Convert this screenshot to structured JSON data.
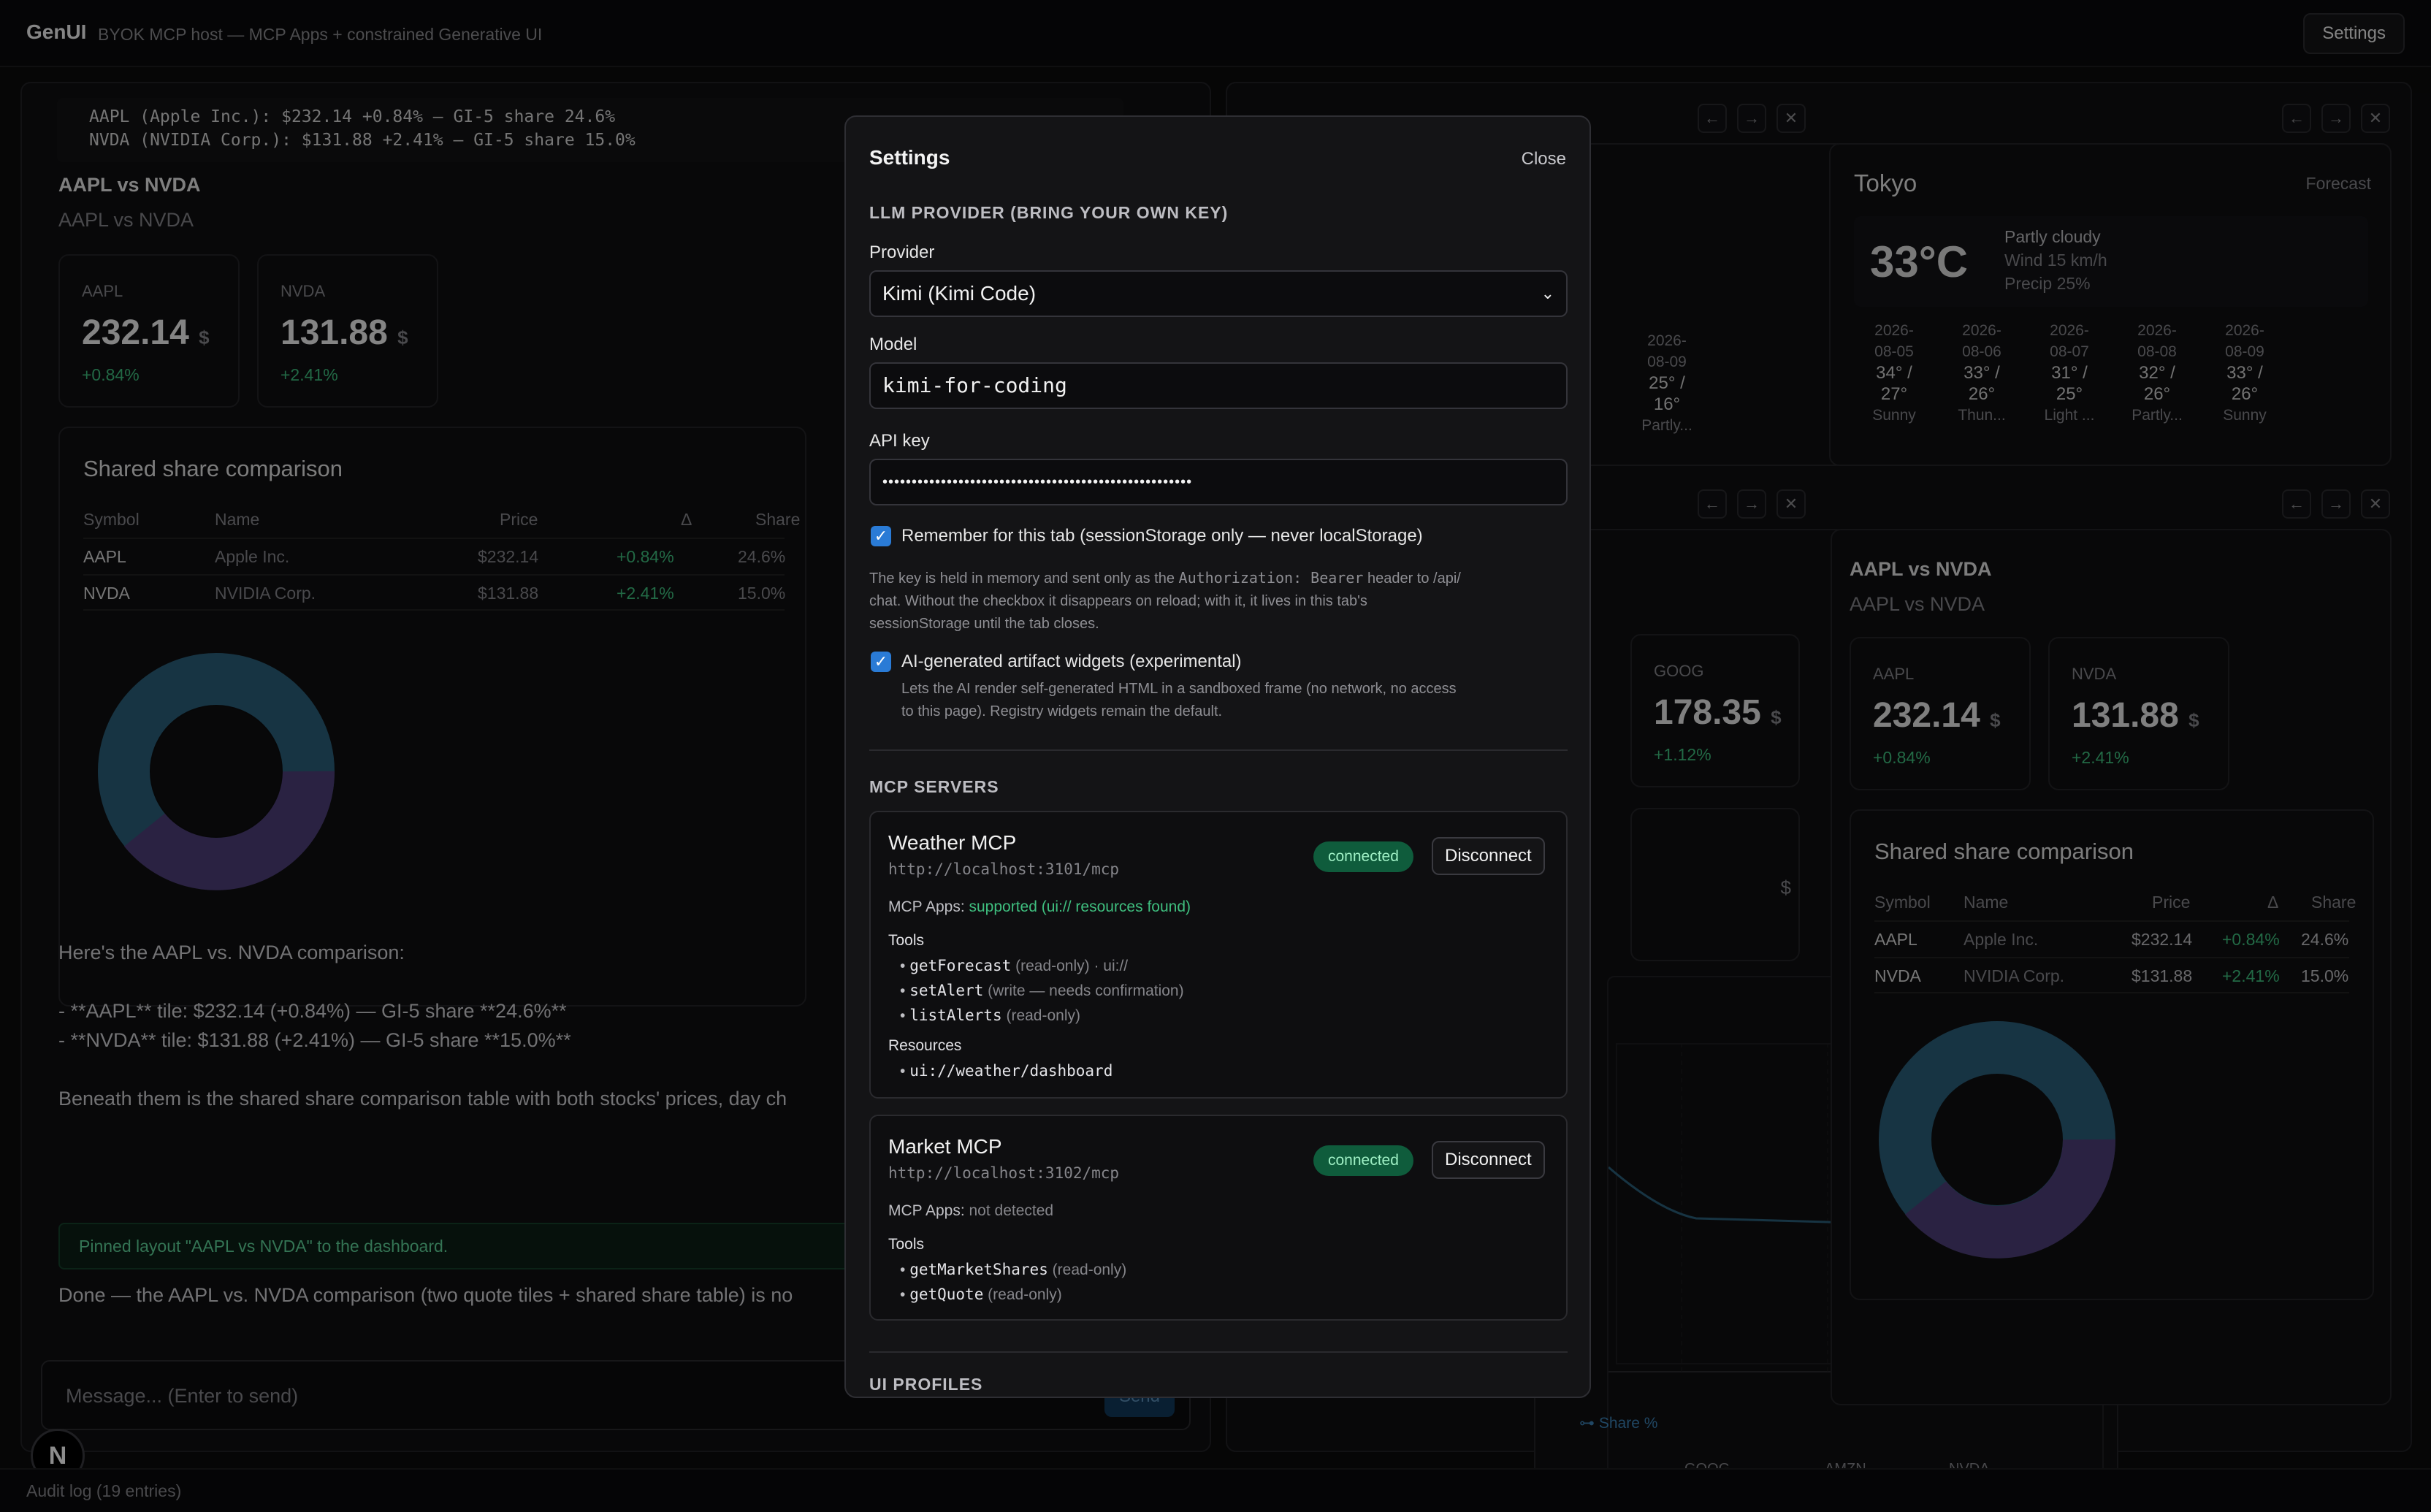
{
  "app": {
    "name": "GenUI",
    "tagline": "BYOK MCP host — MCP Apps + constrained Generative UI",
    "settings_label": "Settings"
  },
  "chat": {
    "code_lines": [
      "AAPL (Apple Inc.): $232.14 +0.84% — GI-5 share 24.6%",
      "NVDA (NVIDIA Corp.): $131.88 +2.41% — GI-5 share 15.0%"
    ],
    "widget_title": "AAPL vs NVDA",
    "widget_subtitle": "AAPL vs NVDA",
    "tiles": [
      {
        "symbol": "AAPL",
        "price": "232.14",
        "currency": "$",
        "change": "+0.84%"
      },
      {
        "symbol": "NVDA",
        "price": "131.88",
        "currency": "$",
        "change": "+2.41%"
      }
    ],
    "table_title": "Shared share comparison",
    "table_headers": [
      "Symbol",
      "Name",
      "Price",
      "Δ",
      "Share"
    ],
    "table_rows": [
      [
        "AAPL",
        "Apple Inc.",
        "$232.14",
        "+0.84%",
        "24.6%"
      ],
      [
        "NVDA",
        "NVIDIA Corp.",
        "$131.88",
        "+2.41%",
        "15.0%"
      ]
    ],
    "donut_shares": [
      24.6,
      15.0
    ],
    "message_intro": "Here's the AAPL vs. NVDA comparison:",
    "message_bullet_1": "- **AAPL** tile: $232.14 (+0.84%) — GI-5 share **24.6%**",
    "message_bullet_2": "- **NVDA** tile: $131.88 (+2.41%) — GI-5 share **15.0%**",
    "message_beneath": "Beneath them is the shared share comparison table with both stocks' prices, day ch",
    "pinned_notice": "Pinned layout \"AAPL vs NVDA\" to the dashboard.",
    "done_text": "Done — the AAPL vs. NVDA comparison (two quote tiles + shared share table) is no",
    "input_placeholder": "Message... (Enter to send)",
    "send_label": "Send",
    "avatar_letter": "N"
  },
  "dashboard": {
    "forecast_label": "Forecast",
    "tokyo": {
      "city": "Tokyo",
      "temp": "33°C",
      "cond": "Partly cloudy",
      "wind": "Wind 15 km/h",
      "precip": "Precip 25%",
      "days": [
        {
          "d1": "2026-",
          "d2": "08-05",
          "hl": "34° /",
          "lo": "27°",
          "c": "Sunny"
        },
        {
          "d1": "2026-",
          "d2": "08-06",
          "hl": "33° /",
          "lo": "26°",
          "c": "Thun..."
        },
        {
          "d1": "2026-",
          "d2": "08-07",
          "hl": "31° /",
          "lo": "25°",
          "c": "Light ..."
        },
        {
          "d1": "2026-",
          "d2": "08-08",
          "hl": "32° /",
          "lo": "26°",
          "c": "Partly..."
        },
        {
          "d1": "2026-",
          "d2": "08-09",
          "hl": "33° /",
          "lo": "26°",
          "c": "Sunny"
        }
      ]
    },
    "left_weather_day": {
      "d1": "2026-",
      "d2": "08-09",
      "hl": "25° /",
      "lo": "16°",
      "c": "Partly..."
    },
    "goog_tile": {
      "symbol": "GOOG",
      "price": "178.35",
      "currency": "$",
      "change": "+1.12%"
    },
    "chart_ticks": [
      "GOOG",
      "AMZN",
      "NVDA"
    ],
    "chart_legend": "Share %"
  },
  "audit": {
    "label": "Audit log (19 entries)"
  },
  "modal": {
    "title": "Settings",
    "close_label": "Close",
    "llm_section": "LLM PROVIDER (BRING YOUR OWN KEY)",
    "provider_label": "Provider",
    "provider_value": "Kimi (Kimi Code)",
    "model_label": "Model",
    "model_value": "kimi-for-coding",
    "apikey_label": "API key",
    "apikey_value": "•••••••••••••••••••••••••••••••••••••••••••••••••••••",
    "remember_label": "Remember for this tab (sessionStorage only — never localStorage)",
    "help_1a": "The key is held in memory and sent only as the ",
    "help_1b": "Authorization: Bearer",
    "help_1c": " header to /api/",
    "help_2": "chat. Without the checkbox it disappears on reload; with it, it lives in this tab's",
    "help_3": "sessionStorage until the tab closes.",
    "ai_label": "AI-generated artifact widgets (experimental)",
    "ai_help_1": "Lets the AI render self-generated HTML in a sandboxed frame (no network, no access",
    "ai_help_2": "to this page). Registry widgets remain the default.",
    "mcp_section": "MCP SERVERS",
    "servers": [
      {
        "name": "Weather MCP",
        "url": "http://localhost:3101/mcp",
        "status": "connected",
        "action": "Disconnect",
        "apps_prefix": "MCP Apps: ",
        "apps_value": "supported (ui:// resources found)",
        "tools_label": "Tools",
        "tools": [
          {
            "name": "getForecast",
            "note": " (read-only) · ui://"
          },
          {
            "name": "setAlert",
            "note": " (write — needs confirmation)"
          },
          {
            "name": "listAlerts",
            "note": " (read-only)"
          }
        ],
        "resources_label": "Resources",
        "resource": "ui://weather/dashboard"
      },
      {
        "name": "Market MCP",
        "url": "http://localhost:3102/mcp",
        "status": "connected",
        "action": "Disconnect",
        "apps_prefix": "MCP Apps: ",
        "apps_value": "not detected",
        "tools_label": "Tools",
        "tools": [
          {
            "name": "getMarketShares",
            "note": " (read-only)"
          },
          {
            "name": "getQuote",
            "note": " (read-only)"
          }
        ]
      }
    ],
    "ui_section": "UI PROFILES"
  },
  "colors": {
    "donut_teal": "#2a5f7a",
    "donut_purple": "#4e3f78",
    "positive": "#3fbf7f",
    "accent_blue": "#2a7bd6"
  }
}
